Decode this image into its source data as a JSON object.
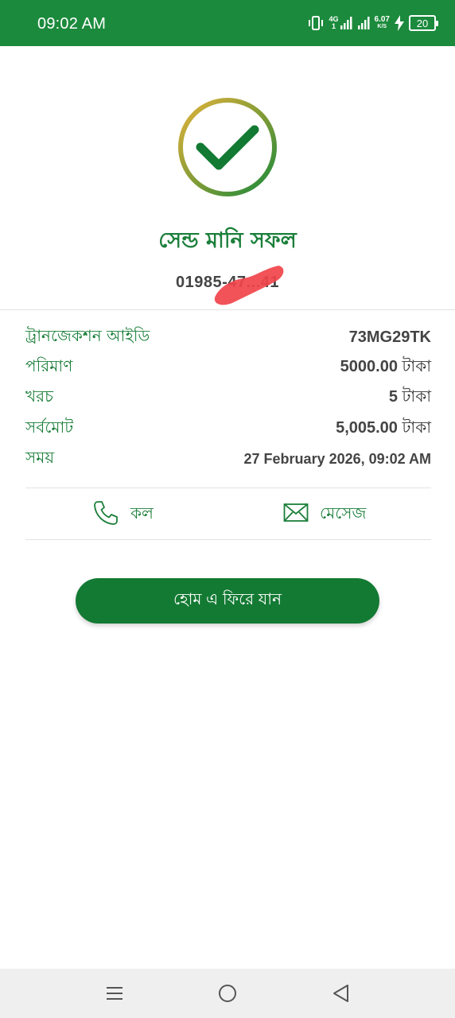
{
  "status_bar": {
    "time": "09:02 AM",
    "network_type": "4G",
    "network_sub": "1",
    "speed_value": "6.07",
    "speed_unit": "K/S",
    "battery": "20",
    "background": "#1b8a3c"
  },
  "result": {
    "title": "সেন্ড মানি সফল",
    "account_number": "01985-47...41"
  },
  "details": [
    {
      "label": "ট্রানজেকশন আইডি",
      "value": "73MG29TK",
      "unit": ""
    },
    {
      "label": "পরিমাণ",
      "value": "5000.00",
      "unit": "টাকা"
    },
    {
      "label": "খরচ",
      "value": "5",
      "unit": "টাকা"
    },
    {
      "label": "সর্বমোট",
      "value": "5,005.00",
      "unit": "টাকা"
    },
    {
      "label": "সময়",
      "value": "27 February 2026, 09:02 AM",
      "unit": ""
    }
  ],
  "actions": {
    "call_label": "কল",
    "message_label": "মেসেজ"
  },
  "home_button_label": "হোম এ ফিরে যান",
  "colors": {
    "primary_green": "#1b7f3a",
    "button_green": "#137a33",
    "ring_gold": "#e0b03a"
  },
  "icons": {
    "success": "check-circle-icon",
    "call": "phone-icon",
    "message": "envelope-icon",
    "nav_menu": "menu-icon",
    "nav_home": "home-circle-icon",
    "nav_back": "back-triangle-icon"
  }
}
